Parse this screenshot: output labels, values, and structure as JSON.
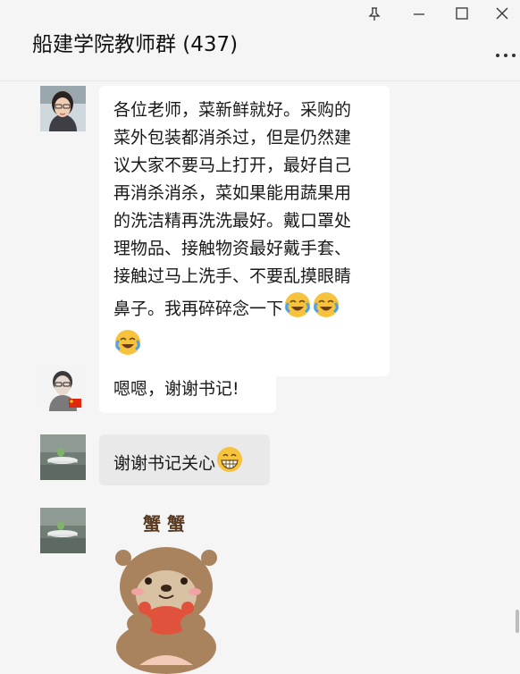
{
  "window": {
    "title": "船建学院教师群 (437)",
    "controls": {
      "pin_icon": "pin-icon",
      "minimize_icon": "minimize-icon",
      "maximize_icon": "maximize-icon",
      "close_icon": "close-icon",
      "more_icon": "more-icon"
    }
  },
  "messages": [
    {
      "avatar": "woman-with-glasses",
      "text_lines": [
        "各位老师，菜新鲜就好。采购的",
        "菜外包装都消杀过，但是仍然建",
        "议大家不要马上打开，最好自己",
        "再消杀消杀，菜如果能用蔬果用",
        "的洗洁精再洗洗最好。戴口罩处",
        "理物品、接触物资最好戴手套、",
        "接触过马上洗手、不要乱摸眼睛",
        "鼻子。我再碎碎念一下"
      ],
      "emojis": [
        "laughing-tears-emoji",
        "laughing-tears-emoji",
        "laughing-tears-emoji"
      ]
    },
    {
      "avatar": "man-with-glasses-flag",
      "text": "嗯嗯，谢谢书记!"
    },
    {
      "avatar": "boat-on-water",
      "text": "谢谢书记关心",
      "emoji": "grinning-teeth-emoji"
    },
    {
      "avatar": "boat-on-water",
      "sticker": {
        "caption": "蟹 蟹",
        "description": "otter-holding-crab-sticker"
      }
    }
  ],
  "colors": {
    "background": "#f5f5f5",
    "bubble": "#ffffff",
    "bubble_gray": "#e9e9e9",
    "emoji_yellow": "#f7c33c"
  }
}
